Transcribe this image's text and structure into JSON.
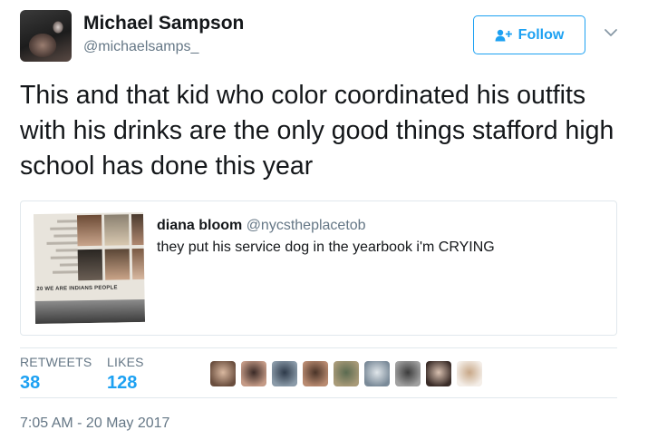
{
  "author": {
    "display_name": "Michael Sampson",
    "handle": "@michaelsamps_"
  },
  "follow_button": {
    "label": "Follow",
    "icon": "person-plus-icon"
  },
  "menu": {
    "icon": "chevron-down-icon"
  },
  "tweet": {
    "text": "This and that kid who color coordinated his outfits with his drinks are the only good things stafford high school has done this year"
  },
  "quoted_tweet": {
    "display_name": "diana bloom",
    "handle": "@nycstheplacetob",
    "text": "they put his service dog in the yearbook i'm CRYING",
    "image_caption": "20 WE ARE INDIANS PEOPLE"
  },
  "stats": {
    "retweets_label": "RETWEETS",
    "retweets": "38",
    "likes_label": "LIKES",
    "likes": "128"
  },
  "likers": [
    {
      "colors": [
        "#d9b8a0",
        "#6a4e3e"
      ]
    },
    {
      "colors": [
        "#3a2a26",
        "#c49a86"
      ]
    },
    {
      "colors": [
        "#2e3a4a",
        "#8a9aa8"
      ]
    },
    {
      "colors": [
        "#4a3428",
        "#b88a70"
      ]
    },
    {
      "colors": [
        "#5a6a50",
        "#a89a78"
      ]
    },
    {
      "colors": [
        "#e0e6ea",
        "#7a8a98"
      ]
    },
    {
      "colors": [
        "#3c3c3c",
        "#a0a0a0"
      ]
    },
    {
      "colors": [
        "#d8c0b0",
        "#3a2c28"
      ]
    },
    {
      "colors": [
        "#c8a888",
        "#f4eee8"
      ]
    }
  ],
  "timestamp": "7:05 AM - 20 May 2017",
  "colors": {
    "accent": "#1da1f2",
    "secondary_text": "#657786",
    "border": "#e1e8ed"
  }
}
